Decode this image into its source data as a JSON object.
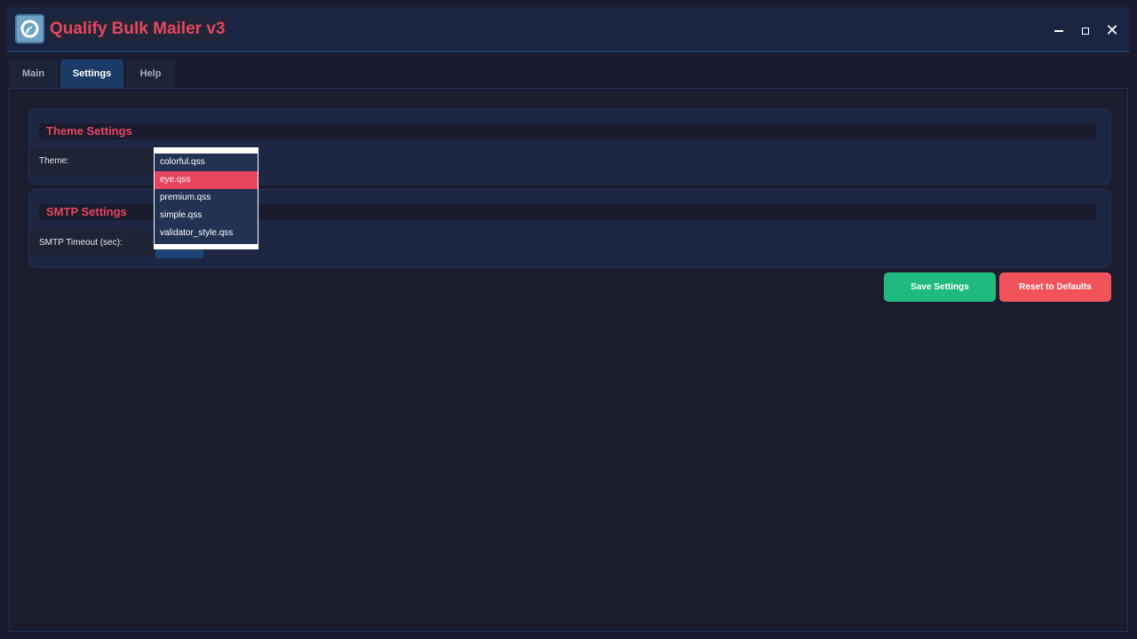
{
  "app": {
    "title": "Qualify Bulk Mailer v3",
    "logo_icon": "chat-signal-icon",
    "window_controls": {
      "minimize": "minimize-icon",
      "maximize": "maximize-icon",
      "close": "✕"
    }
  },
  "tabs": [
    {
      "label": "Main",
      "active": false
    },
    {
      "label": "Settings",
      "active": true
    },
    {
      "label": "Help",
      "active": false
    }
  ],
  "theme_settings": {
    "title": "Theme Settings",
    "theme_label": "Theme:",
    "dropdown_options": [
      "colorful.qss",
      "eye.qss",
      "premium.qss",
      "simple.qss",
      "validator_style.qss"
    ],
    "highlighted_option": "eye.qss"
  },
  "smtp_settings": {
    "title": "SMTP Settings",
    "timeout_label": "SMTP Timeout (sec):"
  },
  "actions": {
    "save_label": "Save Settings",
    "reset_label": "Reset to Defaults"
  },
  "colors": {
    "accent": "#e8455f",
    "save": "#1fba80",
    "reset": "#f2535a",
    "background": "#1a1b2e",
    "active_tab": "#1b3a66"
  }
}
